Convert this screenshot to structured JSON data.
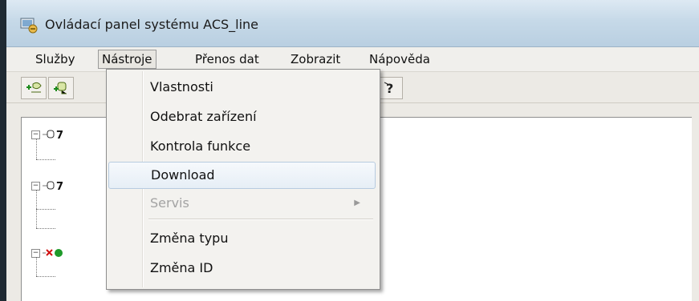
{
  "window": {
    "title": "Ovládací panel systému ACS_line"
  },
  "menubar": {
    "items": [
      {
        "label": "Služby"
      },
      {
        "label": "Nástroje"
      },
      {
        "label": "Přenos dat"
      },
      {
        "label": "Zobrazit"
      },
      {
        "label": "Nápověda"
      }
    ],
    "active_item": "Nástroje"
  },
  "dropdown": {
    "items": [
      {
        "label": "Vlastnosti",
        "state": "normal"
      },
      {
        "label": "Odebrat zařízení",
        "state": "normal"
      },
      {
        "label": "Kontrola funkce",
        "state": "normal"
      },
      {
        "label": "Download",
        "state": "highlighted"
      },
      {
        "label": "Servis",
        "state": "disabled",
        "has_submenu": true
      },
      {
        "label": "Změna typu",
        "state": "normal"
      },
      {
        "label": "Změna ID",
        "state": "normal"
      }
    ]
  },
  "toolbar": {
    "buttons": [
      {
        "icon": "add-device-icon"
      },
      {
        "icon": "device-connect-icon"
      },
      {
        "icon": "help-icon"
      }
    ]
  },
  "tree": {
    "nodes": [
      {
        "icon": "key-device-icon",
        "expanded": true
      },
      {
        "icon": "key-device-icon",
        "expanded": true
      },
      {
        "icon": "disconnected-device-icon",
        "expanded": true
      }
    ]
  },
  "colors": {
    "titlebar": "#c6d9e8",
    "menu_highlight": "#e6eef6",
    "disabled_text": "#a3a3a3",
    "error_red": "#d01010",
    "status_green": "#1e9a2a"
  }
}
